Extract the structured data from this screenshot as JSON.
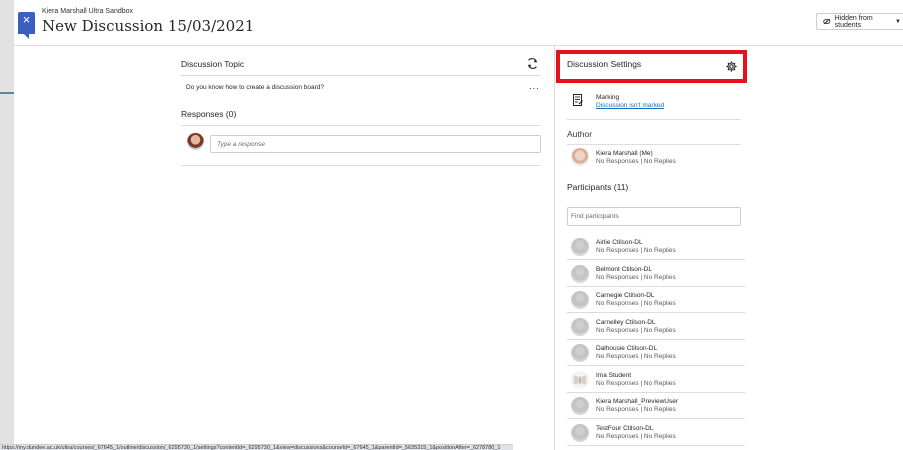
{
  "header": {
    "close_icon": "close-icon",
    "course_name": "Kiera Marshall Ultra Sandbox",
    "title": "New Discussion 15/03/2021",
    "visibility_label": "Hidden from students",
    "visibility_icon": "eye-slash-icon"
  },
  "topic": {
    "heading": "Discussion Topic",
    "question": "Do you know how to create a discussion board?",
    "more_glyph": "···"
  },
  "responses": {
    "heading": "Responses (0)",
    "input_placeholder": "Type a response"
  },
  "settings": {
    "heading": "Discussion Settings",
    "marking_label": "Marking",
    "marking_link": "Discussion isn't marked"
  },
  "author": {
    "heading": "Author",
    "name": "Kiera Marshall (Me)",
    "stats": "No Responses | No Replies"
  },
  "participants": {
    "heading": "Participants (11)",
    "search_placeholder": "Find participants",
    "items": [
      {
        "name": "Airlie Ctilson-DL",
        "stats": "No Responses | No Replies"
      },
      {
        "name": "Belmont Ctilson-DL",
        "stats": "No Responses | No Replies"
      },
      {
        "name": "Carnegie Ctilson-DL",
        "stats": "No Responses | No Replies"
      },
      {
        "name": "Carnelley Ctilson-DL",
        "stats": "No Responses | No Replies"
      },
      {
        "name": "Dalhousie Ctilson-DL",
        "stats": "No Responses | No Replies"
      },
      {
        "name": "Ima Student",
        "stats": "No Responses | No Replies"
      },
      {
        "name": "Kiera Marshall_PreviewUser",
        "stats": "No Responses | No Replies"
      },
      {
        "name": "TestFour Ctilson-DL",
        "stats": "No Responses | No Replies"
      }
    ]
  },
  "status_bar": {
    "url": "https://my.dundee.ac.uk/ultra/courses/_67645_1/outline/discussion/_6295730_1/settings?contentId=_6295730_1&view=discussions&courseId=_67645_1&parentId=_5635315_1&positionAfter=_6278780_1"
  },
  "colors": {
    "accent": "#3b5fc0",
    "highlight": "#e8101a",
    "link": "#1a6fbd"
  }
}
